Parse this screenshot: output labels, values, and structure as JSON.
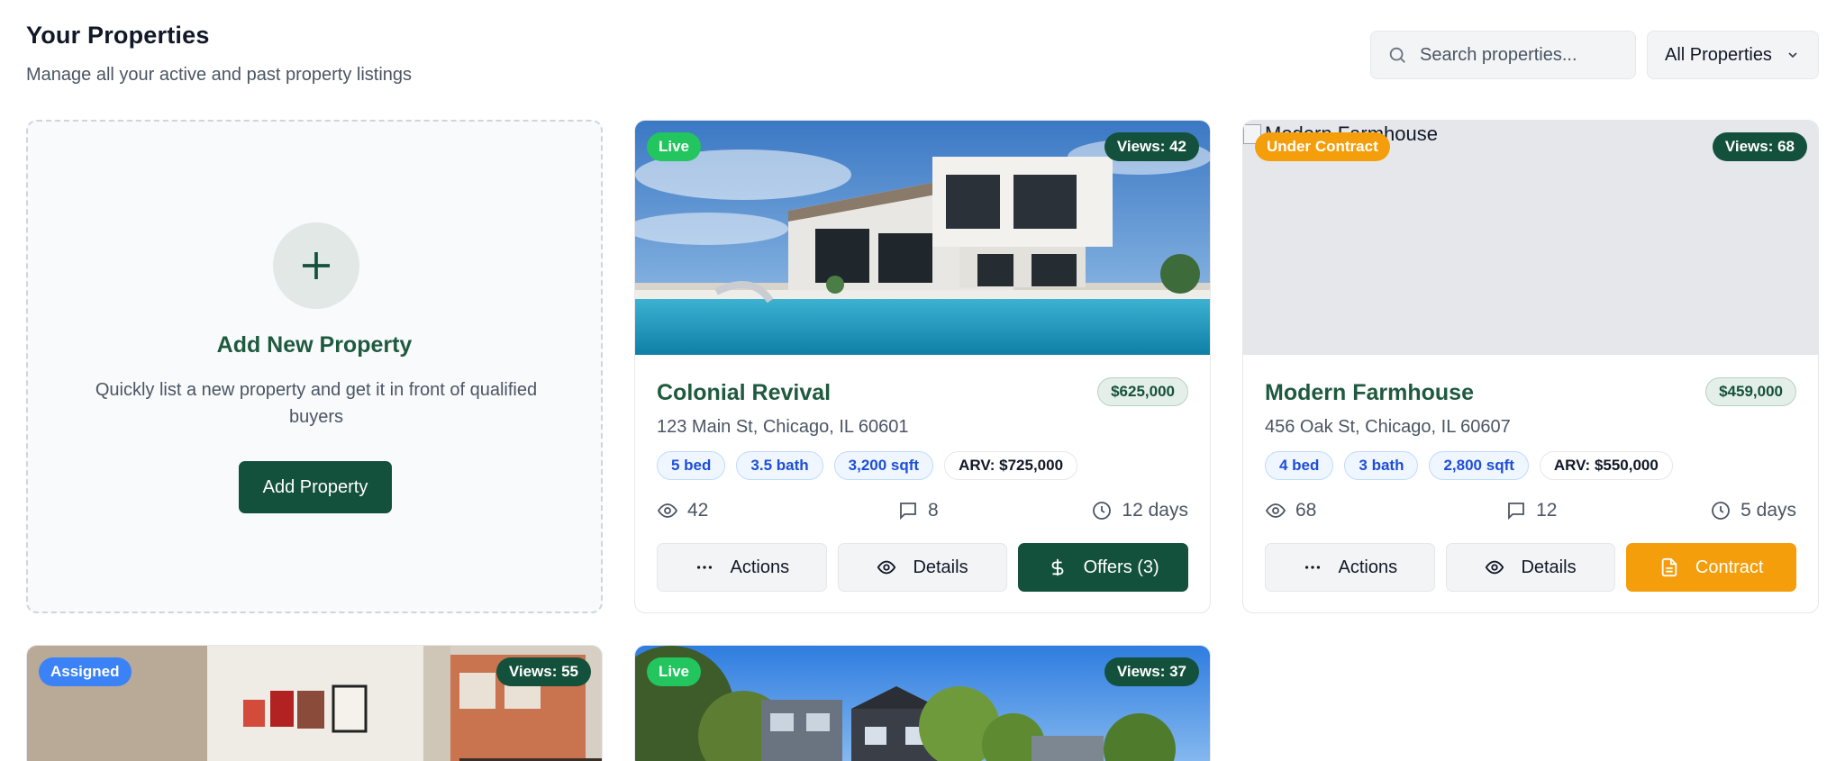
{
  "header": {
    "title": "Your Properties",
    "subtitle": "Manage all your active and past property listings"
  },
  "search": {
    "placeholder": "Search properties..."
  },
  "filter": {
    "selected": "All Properties"
  },
  "add_card": {
    "title": "Add New Property",
    "description": "Quickly list a new property and get it in front of qualified buyers",
    "button_label": "Add Property"
  },
  "properties": [
    {
      "status": "Live",
      "status_color": "#22c55e",
      "views_badge": "Views: 42",
      "title": "Colonial Revival",
      "price": "$625,000",
      "address": "123 Main St, Chicago, IL 60601",
      "beds": "5 bed",
      "baths": "3.5 bath",
      "sqft": "3,200 sqft",
      "arv": "ARV: $725,000",
      "views": "42",
      "comments": "8",
      "days": "12 days",
      "actions_label": "Actions",
      "details_label": "Details",
      "primary_label": "Offers (3)",
      "primary_icon": "dollar-icon"
    },
    {
      "status": "Under Contract",
      "status_color": "#f59e0b",
      "views_badge": "Views: 68",
      "image_alt": "Modern Farmhouse",
      "title": "Modern Farmhouse",
      "price": "$459,000",
      "address": "456 Oak St, Chicago, IL 60607",
      "beds": "4 bed",
      "baths": "3 bath",
      "sqft": "2,800 sqft",
      "arv": "ARV: $550,000",
      "views": "68",
      "comments": "12",
      "days": "5 days",
      "actions_label": "Actions",
      "details_label": "Details",
      "primary_label": "Contract",
      "primary_icon": "document-icon"
    },
    {
      "status": "Assigned",
      "status_color": "#3b82f6",
      "views_badge": "Views: 55"
    },
    {
      "status": "Live",
      "status_color": "#22c55e",
      "views_badge": "Views: 37"
    }
  ]
}
